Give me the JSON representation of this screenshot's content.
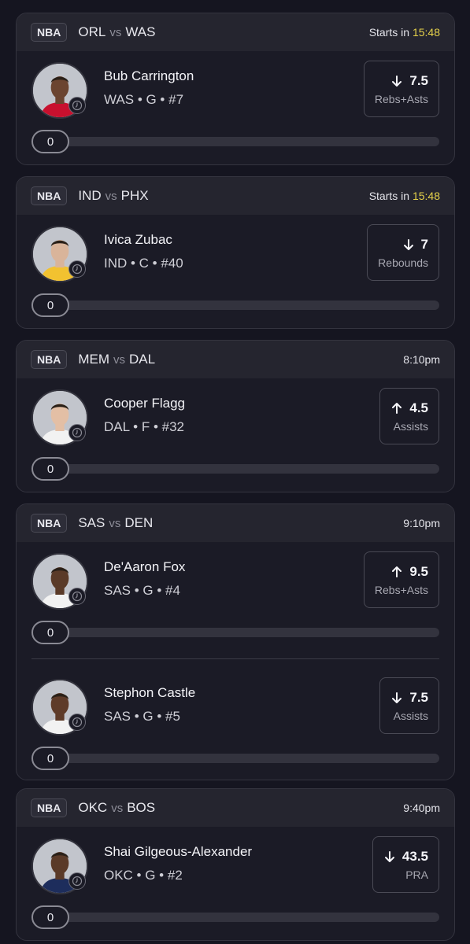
{
  "games": [
    {
      "league": "NBA",
      "home": "ORL",
      "vs": "vs",
      "away": "WAS",
      "start_prefix": "Starts in ",
      "start_time": "15:48",
      "time_highlight": true,
      "players": [
        {
          "name": "Bub Carrington",
          "meta": "WAS • G • #7",
          "direction": "down",
          "line": "7.5",
          "stat": "Rebs+Asts",
          "progress": "0",
          "jersey": "#c8102e",
          "skin": "#6b4430"
        }
      ]
    },
    {
      "league": "NBA",
      "home": "IND",
      "vs": "vs",
      "away": "PHX",
      "start_prefix": "Starts in ",
      "start_time": "15:48",
      "time_highlight": true,
      "players": [
        {
          "name": "Ivica Zubac",
          "meta": "IND • C • #40",
          "direction": "down",
          "line": "7",
          "stat": "Rebounds",
          "progress": "0",
          "jersey": "#f2c230",
          "skin": "#d9b49a"
        }
      ]
    },
    {
      "league": "NBA",
      "home": "MEM",
      "vs": "vs",
      "away": "DAL",
      "start_prefix": "",
      "start_time": "8:10pm",
      "time_highlight": false,
      "players": [
        {
          "name": "Cooper Flagg",
          "meta": "DAL • F • #32",
          "direction": "up",
          "line": "4.5",
          "stat": "Assists",
          "progress": "0",
          "jersey": "#f2f2f2",
          "skin": "#e3bfa5"
        }
      ]
    },
    {
      "league": "NBA",
      "home": "SAS",
      "vs": "vs",
      "away": "DEN",
      "start_prefix": "",
      "start_time": "9:10pm",
      "time_highlight": false,
      "players": [
        {
          "name": "De'Aaron Fox",
          "meta": "SAS • G • #4",
          "direction": "up",
          "line": "9.5",
          "stat": "Rebs+Asts",
          "progress": "0",
          "jersey": "#f2f2f2",
          "skin": "#5a3a28"
        },
        {
          "name": "Stephon Castle",
          "meta": "SAS • G • #5",
          "direction": "down",
          "line": "7.5",
          "stat": "Assists",
          "progress": "0",
          "jersey": "#f2f2f2",
          "skin": "#5e3b29"
        }
      ]
    },
    {
      "league": "NBA",
      "home": "OKC",
      "vs": "vs",
      "away": "BOS",
      "start_prefix": "",
      "start_time": "9:40pm",
      "time_highlight": false,
      "players": [
        {
          "name": "Shai Gilgeous-Alexander",
          "meta": "OKC • G • #2",
          "direction": "down",
          "line": "43.5",
          "stat": "PRA",
          "progress": "0",
          "jersey": "#1d2d5c",
          "skin": "#5a3a28"
        }
      ]
    }
  ],
  "colors": {
    "background": "#151520",
    "card": "#1b1b26",
    "header": "#25252f",
    "highlight": "#e6d24a"
  },
  "icons": {
    "arrow_up": "arrow-up-icon",
    "arrow_down": "arrow-down-icon",
    "clock": "clock-icon"
  }
}
